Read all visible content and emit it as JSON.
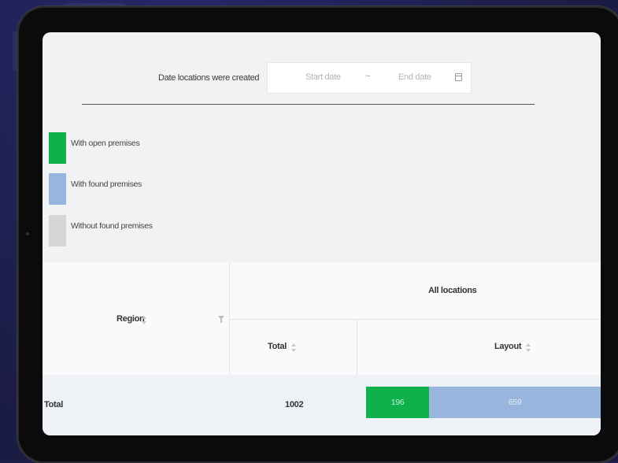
{
  "filter": {
    "label": "Date locations were created",
    "start_placeholder": "Start date",
    "separator": "~",
    "end_placeholder": "End date"
  },
  "legend": [
    {
      "label": "With open premises",
      "color": "#0fb14d"
    },
    {
      "label": "With found premises",
      "color": "#97b5dd"
    },
    {
      "label": "Without found premises",
      "color": "#d6d6d6"
    }
  ],
  "table": {
    "headers": {
      "region": "Region",
      "all_locations": "All locations",
      "total": "Total",
      "layout": "Layout"
    },
    "rows": [
      {
        "region": "Total",
        "total": "1002",
        "layout": {
          "open": 196,
          "found": 659
        }
      }
    ]
  },
  "colors": {
    "open": "#0fb14d",
    "found": "#97b5dd",
    "none": "#d6d6d6"
  }
}
